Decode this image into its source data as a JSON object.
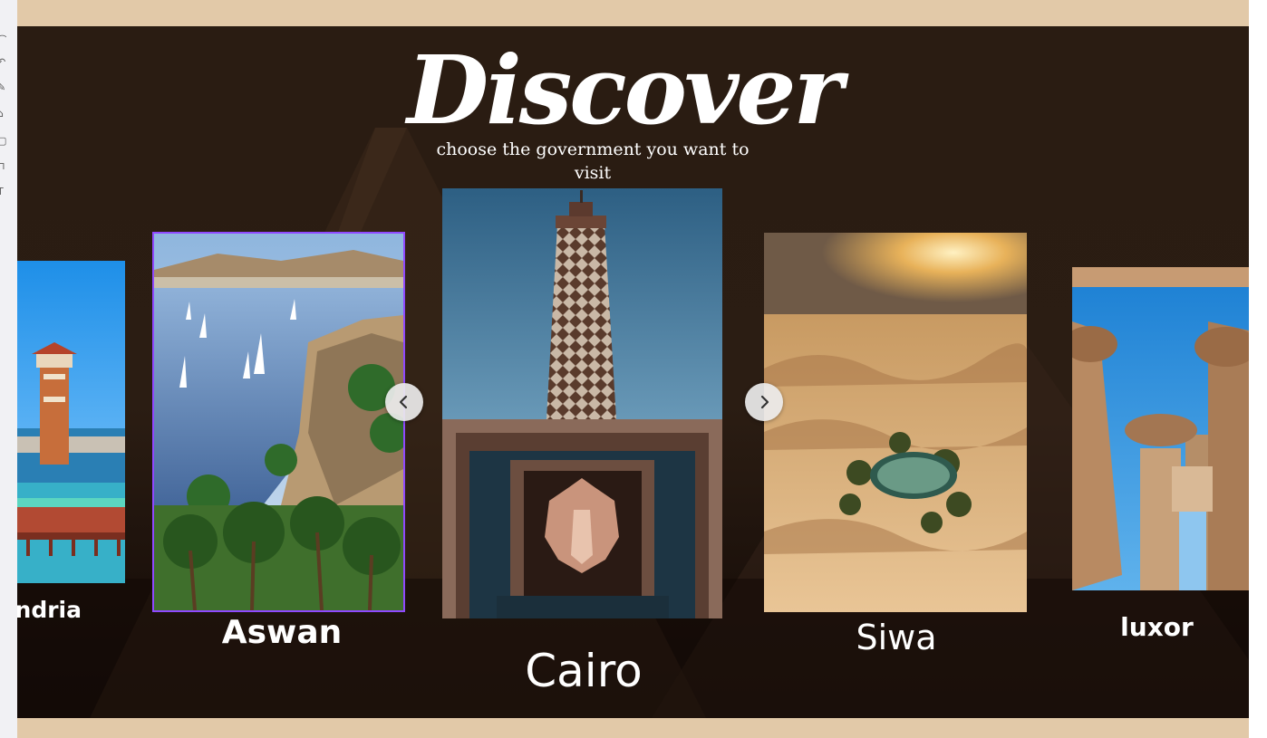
{
  "hero": {
    "title": "Discover",
    "subtitle": "choose the government you want to visit"
  },
  "carousel": {
    "cards": [
      {
        "label": "andria",
        "image": "alexandria-montaza-tower-photo"
      },
      {
        "label": "Aswan",
        "image": "aswan-nile-feluccas-photo",
        "selected": true
      },
      {
        "label": "Cairo",
        "image": "cairo-tower-photo",
        "active": true
      },
      {
        "label": "Siwa",
        "image": "siwa-oasis-desert-photo"
      },
      {
        "label": "luxor",
        "image": "luxor-karnak-columns-photo"
      }
    ],
    "prev_icon": "chevron-left-icon",
    "next_icon": "chevron-right-icon"
  },
  "toolbar": {
    "icons": [
      "cursor-icon",
      "undo-icon",
      "pen-icon",
      "tag-icon",
      "box-icon",
      "link-icon",
      "text-icon"
    ]
  },
  "colors": {
    "band": "#e2c9a8",
    "hero_bg": "#2a1c12",
    "selection_border": "#8f49ff",
    "text": "#ffffff"
  }
}
